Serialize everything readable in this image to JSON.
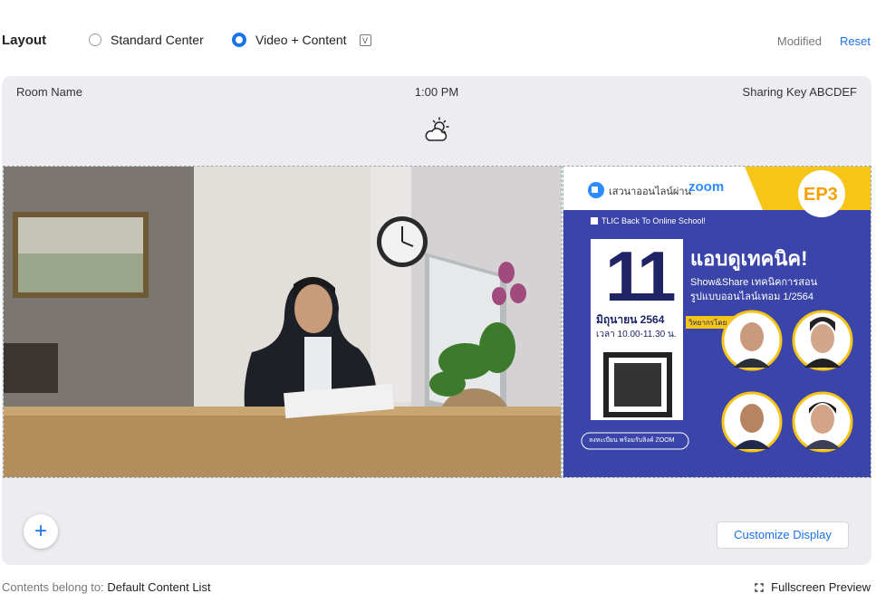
{
  "layout": {
    "label": "Layout",
    "options": [
      {
        "label": "Standard Center",
        "selected": false
      },
      {
        "label": "Video + Content",
        "selected": true
      }
    ],
    "modified_label": "Modified",
    "reset_label": "Reset"
  },
  "preview": {
    "room_name": "Room Name",
    "time": "1:00 PM",
    "sharing_key": "Sharing Key ABCDEF",
    "weather_icon": "cloud-sun-icon",
    "content_slide": {
      "brand": "เสวนาออนไลน์ผ่าน",
      "brand_logo": "zoom",
      "episode": "EP3",
      "checkbox_text": "TLIC Back To Online School!",
      "title": "แอบดูเทคนิค!",
      "subtitle1": "Show&Share เทคนิคการสอน",
      "subtitle2": "รูปแบบออนไลน์เทอม 1/2564",
      "day": "11",
      "month": "มิถุนายน 2564",
      "time": "เวลา 10.00-11.30 น.",
      "speakers_label": "วิทยากรโดย",
      "register": "ลงทะเบียน พร้อมรับลิงค์ ZOOM"
    },
    "add_button": "+",
    "customize_label": "Customize Display"
  },
  "footer": {
    "contents_prefix": "Contents belong to:",
    "contents_value": "Default Content List",
    "fullscreen_label": "Fullscreen Preview"
  },
  "colors": {
    "accent": "#1a73e8",
    "slide_bg": "#3b44a8",
    "slide_yellow": "#f7c518"
  }
}
